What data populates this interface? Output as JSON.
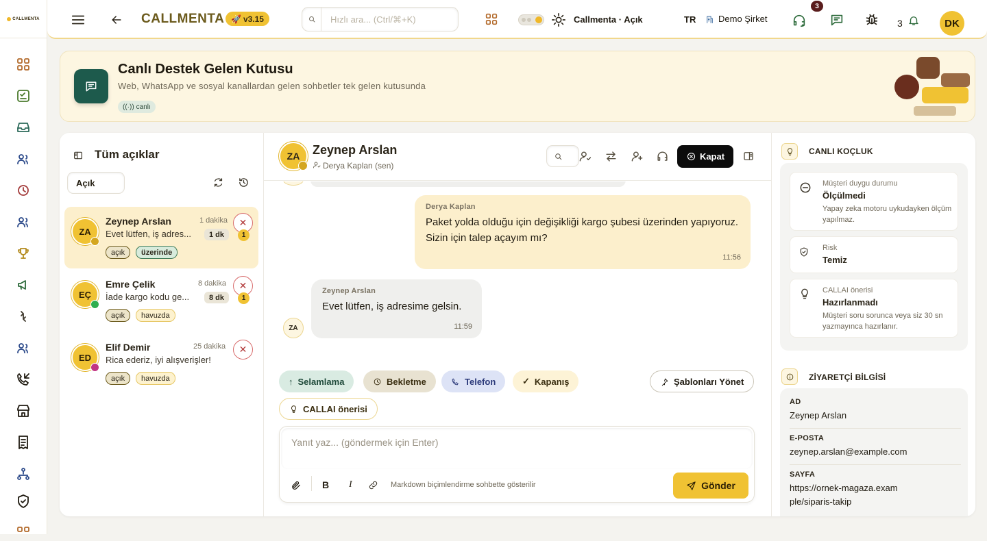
{
  "app": {
    "logo_text": "CALLMENTA",
    "name": "CALLMENTA",
    "version": "v3.15"
  },
  "topbar": {
    "search_placeholder": "Hızlı ara... (Ctrl/⌘+K)",
    "theme_label": "Callmenta · Açık",
    "lang": "TR",
    "company": "Demo Şirket",
    "support_badge": "3",
    "notif_count": "3",
    "avatar": "DK"
  },
  "hero": {
    "title": "Canlı Destek Gelen Kutusu",
    "subtitle": "Web, WhatsApp ve sosyal kanallardan gelen sohbetler tek gelen kutusunda",
    "badge": "canlı"
  },
  "list": {
    "title": "Tüm açıklar",
    "filter": "Açık",
    "items": [
      {
        "initials": "ZA",
        "name": "Zeynep Arslan",
        "time": "1 dakika",
        "preview": "Evet lütfen, iş adres...",
        "dur": "1 dk",
        "unread": "1",
        "channel": "web",
        "tags": [
          "açık",
          "üzerinde"
        ]
      },
      {
        "initials": "EÇ",
        "name": "Emre Çelik",
        "time": "8 dakika",
        "preview": "İade kargo kodu ge...",
        "dur": "8 dk",
        "unread": "1",
        "channel": "whatsapp",
        "tags": [
          "açık",
          "havuzda"
        ]
      },
      {
        "initials": "ED",
        "name": "Elif Demir",
        "time": "25 dakika",
        "preview": "Rica ederiz, iyi alışverişler!",
        "dur": "",
        "unread": "",
        "channel": "instagram",
        "tags": [
          "açık",
          "havuzda"
        ]
      }
    ]
  },
  "chat": {
    "initials": "ZA",
    "name": "Zeynep Arslan",
    "agent": "Derya Kaplan (sen)",
    "close_label": "Kapat",
    "messages": [
      {
        "who": "Derya Kaplan",
        "text": "Paket yolda olduğu için değişikliği kargo şubesi üzerinden yapıyoruz. Sizin için talep açayım mı?",
        "time": "11:56"
      },
      {
        "who": "Zeynep Arslan",
        "text": "Evet lütfen, iş adresime gelsin.",
        "time": "11:59",
        "initials": "ZA"
      }
    ],
    "quick_replies": [
      "Selamlama",
      "Bekletme",
      "Telefon",
      "Kapanış"
    ],
    "suggest_label": "CALLAI önerisi",
    "templates_label": "Şablonları Yönet",
    "input_placeholder": "Yanıt yaz... (göndermek için Enter)",
    "markdown_hint": "Markdown biçimlendirme sohbette gösterilir",
    "send_label": "Gönder"
  },
  "coach": {
    "title": "CANLI KOÇLUK",
    "cards": [
      {
        "label": "Müşteri duygu durumu",
        "value": "Ölçülmedi",
        "desc": "Yapay zeka motoru uykudayken ölçüm yapılmaz."
      },
      {
        "label": "Risk",
        "value": "Temiz",
        "desc": ""
      },
      {
        "label": "CALLAI önerisi",
        "value": "Hazırlanmadı",
        "desc": "Müşteri soru sorunca veya siz 30 sn yazmayınca hazırlanır."
      }
    ]
  },
  "visitor": {
    "title": "ZİYARETÇİ BİLGİSİ",
    "fields": [
      {
        "k": "AD",
        "v": "Zeynep Arslan"
      },
      {
        "k": "E-POSTA",
        "v": "zeynep.arslan@example.com"
      },
      {
        "k": "SAYFA",
        "v": "https://ornek-magaza.example/siparis-takip"
      }
    ]
  },
  "colors": {
    "accent": "#f0c233",
    "brand_dark": "#1d5a4c",
    "hero_bg": "#fdf6e1"
  }
}
